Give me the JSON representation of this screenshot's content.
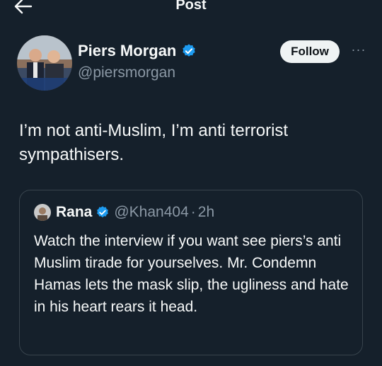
{
  "header": {
    "title": "Post",
    "back_icon": "arrow-left-icon"
  },
  "author": {
    "display_name": "Piers Morgan",
    "handle": "@piersmorgan",
    "verified_icon": "verified-badge-icon",
    "follow_label": "Follow",
    "more_label": "···"
  },
  "tweet": {
    "text": "I’m not anti-Muslim, I’m anti terrorist sympathisers."
  },
  "quote": {
    "display_name": "Rana",
    "handle": "@Khan404",
    "separator": "·",
    "time": "2h",
    "text": "Watch the interview if you want see piers’s anti Muslim tirade for yourselves. Mr. Condemn Hamas lets the mask slip, the ugliness and hate in his heart rears it head."
  },
  "colors": {
    "background": "#15202b",
    "verified": "#1d9bf0",
    "secondary_text": "#8b98a5",
    "border": "#38444d"
  }
}
